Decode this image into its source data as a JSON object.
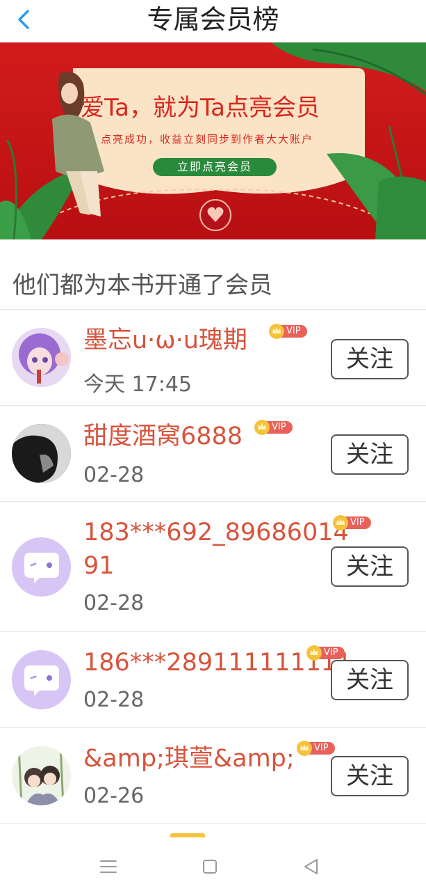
{
  "header": {
    "title": "专属会员榜"
  },
  "banner": {
    "headline": "爱Ta，就为Ta点亮会员",
    "subline": "点亮成功，收益立刻同步到作者大大账户",
    "cta": "立即点亮会员"
  },
  "section_title": "他们都为本书开通了会员",
  "vip_label": "VIP",
  "follow_label": "关注",
  "members": [
    {
      "name": "墨忘u·ω·u瑰期",
      "date": "今天 17:45"
    },
    {
      "name": "甜度酒窝6888",
      "date": "02-28"
    },
    {
      "name": "183***692_89686014",
      "name_cont": "91",
      "date": "02-28"
    },
    {
      "name": "186***289111111111",
      "date": "02-28"
    },
    {
      "name": "&amp;琪萱&amp;",
      "date": "02-26"
    }
  ],
  "colors": {
    "accent": "#d8533c",
    "banner_red": "#c81717",
    "back_arrow": "#2b9af3",
    "default_avatar": "#d7c6f5"
  }
}
